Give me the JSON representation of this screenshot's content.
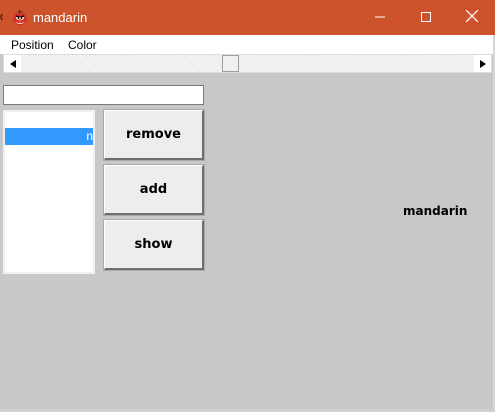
{
  "window": {
    "title": "mandarin",
    "edge_glyph": "o",
    "accent_color": "#cd532c"
  },
  "titlebar_controls": {
    "minimize_icon": "minimize-icon",
    "maximize_icon": "maximize-icon",
    "close_icon": "close-icon"
  },
  "menu": {
    "items": [
      "Position",
      "Color"
    ]
  },
  "scrollbar": {
    "left_arrow": "◀",
    "right_arrow": "▶"
  },
  "text_field": {
    "value": ""
  },
  "list": {
    "items": [
      {
        "label": "n",
        "selected": true
      }
    ],
    "selected_color": "#3399ff"
  },
  "buttons": {
    "remove": "remove",
    "add": "add",
    "show": "show"
  },
  "display_label": "mandarin"
}
